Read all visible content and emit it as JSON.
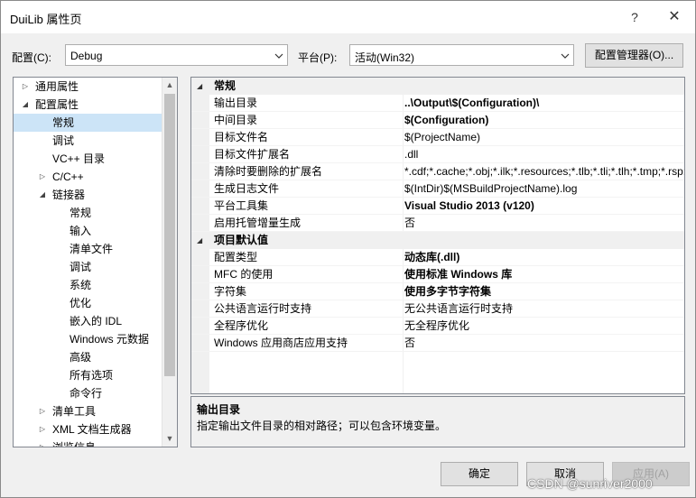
{
  "window": {
    "title": "DuiLib 属性页",
    "help_label": "?",
    "close_label": "✕"
  },
  "config_bar": {
    "config_label": "配置(C):",
    "config_value": "Debug",
    "platform_label": "平台(P):",
    "platform_value": "活动(Win32)",
    "manager_button": "配置管理器(O)..."
  },
  "tree": {
    "items": [
      {
        "label": "通用属性",
        "expander": "▷"
      },
      {
        "label": "配置属性",
        "expander": "◢"
      },
      {
        "label": "常规",
        "expander": ""
      },
      {
        "label": "调试",
        "expander": ""
      },
      {
        "label": "VC++ 目录",
        "expander": ""
      },
      {
        "label": "C/C++",
        "expander": "▷"
      },
      {
        "label": "链接器",
        "expander": "◢"
      },
      {
        "label": "常规",
        "expander": ""
      },
      {
        "label": "输入",
        "expander": ""
      },
      {
        "label": "清单文件",
        "expander": ""
      },
      {
        "label": "调试",
        "expander": ""
      },
      {
        "label": "系统",
        "expander": ""
      },
      {
        "label": "优化",
        "expander": ""
      },
      {
        "label": "嵌入的 IDL",
        "expander": ""
      },
      {
        "label": "Windows 元数据",
        "expander": ""
      },
      {
        "label": "高级",
        "expander": ""
      },
      {
        "label": "所有选项",
        "expander": ""
      },
      {
        "label": "命令行",
        "expander": ""
      },
      {
        "label": "清单工具",
        "expander": "▷"
      },
      {
        "label": "XML 文档生成器",
        "expander": "▷"
      },
      {
        "label": "浏览信息",
        "expander": "▷"
      }
    ]
  },
  "grid": {
    "categories": [
      {
        "name": "常规",
        "expander": "◢",
        "props": [
          {
            "name": "输出目录",
            "value": "..\\Output\\$(Configuration)\\",
            "bold": true
          },
          {
            "name": "中间目录",
            "value": "$(Configuration)",
            "bold": true
          },
          {
            "name": "目标文件名",
            "value": "$(ProjectName)",
            "bold": false
          },
          {
            "name": "目标文件扩展名",
            "value": ".dll",
            "bold": false
          },
          {
            "name": "清除时要删除的扩展名",
            "value": "*.cdf;*.cache;*.obj;*.ilk;*.resources;*.tlb;*.tli;*.tlh;*.tmp;*.rsp;*.pgc;*.pgd;*.meta;*.tlog;*.manifest;*.res;*.pch;*.exp;*.idb;*.rep;*.xdc;*.pdb;*_manifest.rc;*.bsc;*.sbr;*.xml;*.metagen;*.bi",
            "bold": false
          },
          {
            "name": "生成日志文件",
            "value": "$(IntDir)$(MSBuildProjectName).log",
            "bold": false
          },
          {
            "name": "平台工具集",
            "value": "Visual Studio 2013 (v120)",
            "bold": true
          },
          {
            "name": "启用托管增量生成",
            "value": "否",
            "bold": false
          }
        ]
      },
      {
        "name": "项目默认值",
        "expander": "◢",
        "props": [
          {
            "name": "配置类型",
            "value": "动态库(.dll)",
            "bold": true
          },
          {
            "name": "MFC 的使用",
            "value": "使用标准 Windows 库",
            "bold": true
          },
          {
            "name": "字符集",
            "value": "使用多字节字符集",
            "bold": true
          },
          {
            "name": "公共语言运行时支持",
            "value": "无公共语言运行时支持",
            "bold": false
          },
          {
            "name": "全程序优化",
            "value": "无全程序优化",
            "bold": false
          },
          {
            "name": "Windows 应用商店应用支持",
            "value": "否",
            "bold": false
          }
        ]
      }
    ]
  },
  "description": {
    "title": "输出目录",
    "text": "指定输出文件目录的相对路径；可以包含环境变量。"
  },
  "buttons": {
    "ok": "确定",
    "cancel": "取消",
    "apply": "应用(A)"
  },
  "watermark": "CSDN @sunriver2000",
  "colors": {
    "selection": "#cce4f7",
    "category_bg": "#f0f0f0",
    "window_bg": "#f0f0f0"
  }
}
